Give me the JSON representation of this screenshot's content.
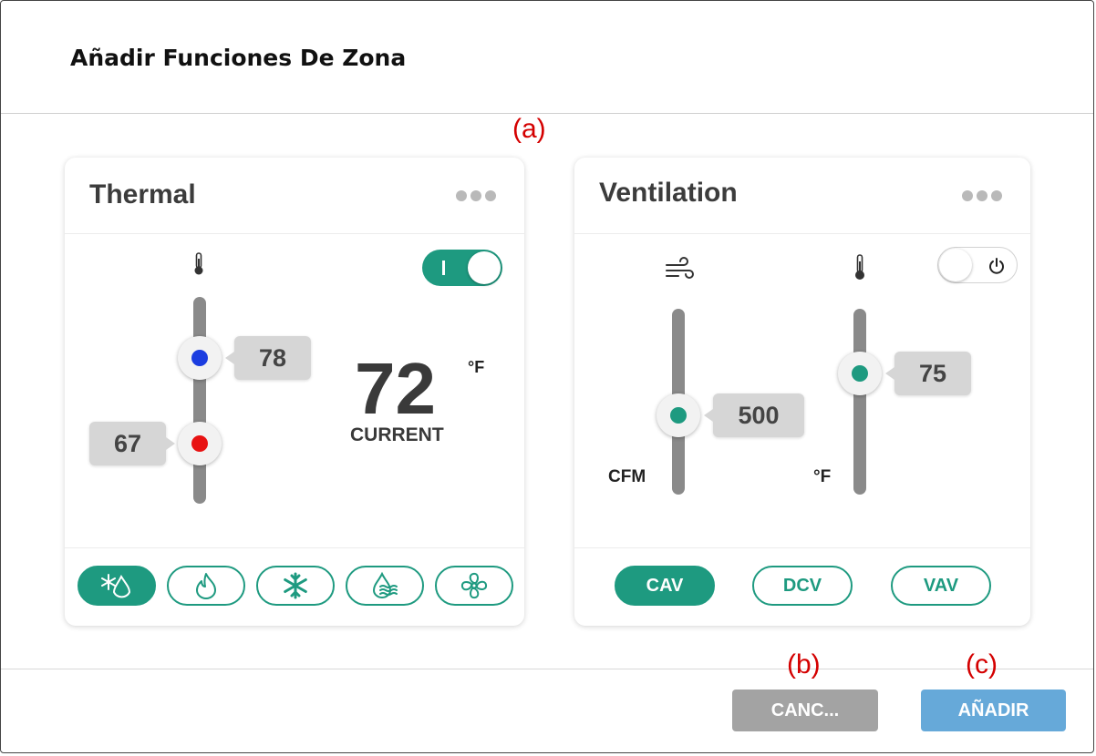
{
  "dialog": {
    "title": "Añadir Funciones De Zona"
  },
  "annotations": {
    "a": "(a)",
    "b": "(b)",
    "c": "(c)"
  },
  "thermal": {
    "title": "Thermal",
    "enabled": true,
    "toggle_label": "I",
    "cool_setpoint": "78",
    "heat_setpoint": "67",
    "current_value": "72",
    "current_label": "CURRENT",
    "unit": "°F",
    "modes": [
      "auto-cool-heat-icon",
      "flame-icon",
      "snowflake-icon",
      "humidity-icon",
      "fan-icon"
    ],
    "active_mode_index": 0,
    "colors": {
      "cool_dot": "#1b3de0",
      "heat_dot": "#e81212",
      "accent": "#1e9a80"
    }
  },
  "ventilation": {
    "title": "Ventilation",
    "enabled": false,
    "airflow_value": "500",
    "airflow_unit": "CFM",
    "temp_value": "75",
    "temp_unit": "°F",
    "modes": [
      "CAV",
      "DCV",
      "VAV"
    ],
    "active_mode": "CAV"
  },
  "footer": {
    "cancel_label": "CANC...",
    "add_label": "AÑADIR",
    "colors": {
      "cancel_bg": "#a3a3a3",
      "add_bg": "#66a9d9"
    }
  }
}
